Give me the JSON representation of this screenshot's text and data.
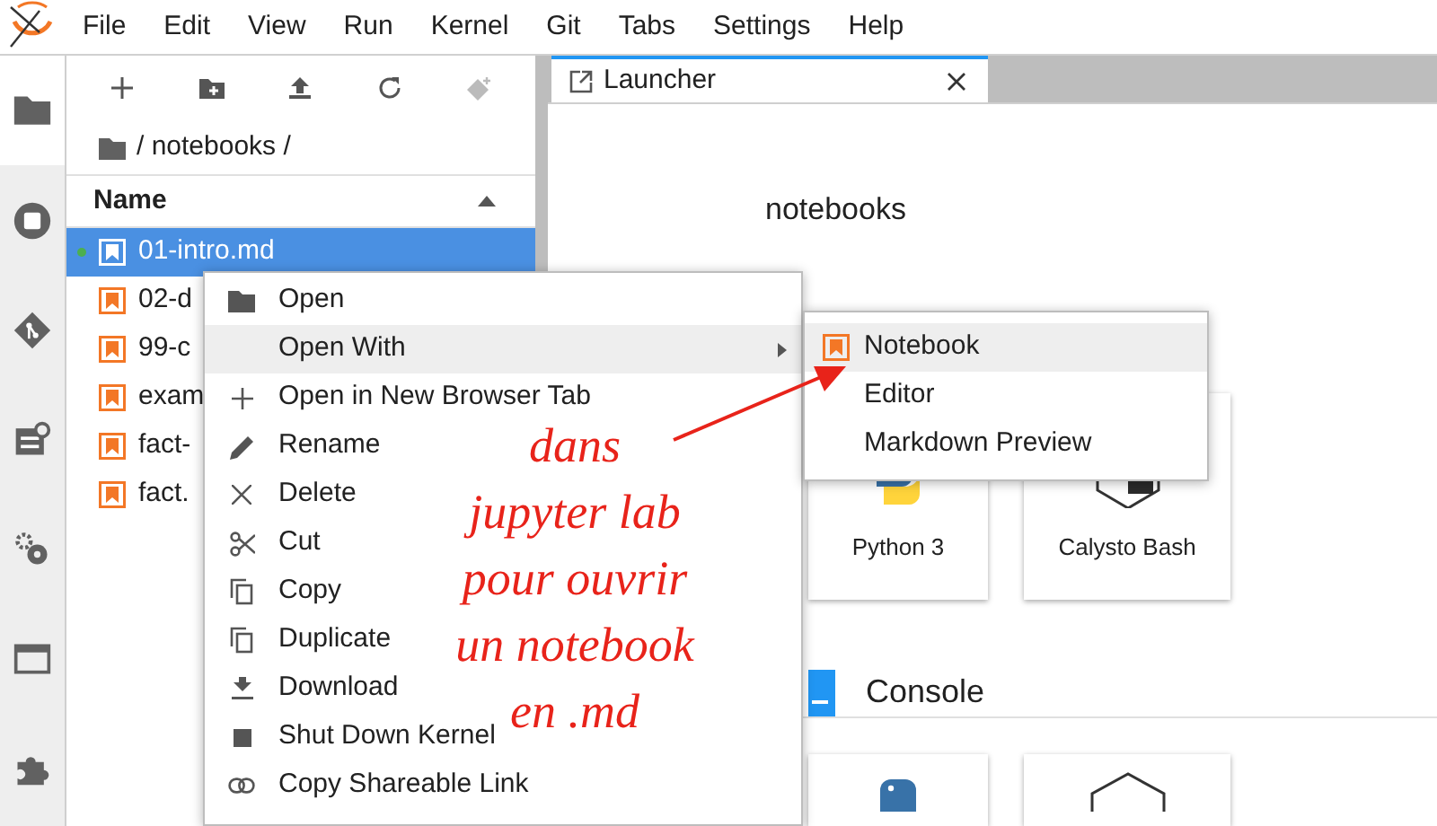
{
  "menu_bar": [
    "File",
    "Edit",
    "View",
    "Run",
    "Kernel",
    "Git",
    "Tabs",
    "Settings",
    "Help"
  ],
  "activity_bar": [
    {
      "selected": true
    },
    {
      "selected": false
    },
    {
      "selected": false
    },
    {
      "selected": false
    },
    {
      "selected": false
    },
    {
      "selected": false
    },
    {
      "selected": false
    }
  ],
  "file_browser": {
    "breadcrumb": "/ notebooks /",
    "column": "Name",
    "files": [
      {
        "name": "01-intro.md",
        "selected": true,
        "running": true
      },
      {
        "name": "02-d",
        "selected": false,
        "running": false
      },
      {
        "name": "99-c",
        "selected": false,
        "running": false
      },
      {
        "name": "exam",
        "selected": false,
        "running": false
      },
      {
        "name": "fact-",
        "selected": false,
        "running": false
      },
      {
        "name": "fact.",
        "selected": false,
        "running": false
      }
    ]
  },
  "tabs": [
    {
      "label": "Launcher",
      "selected": true
    }
  ],
  "launcher": {
    "folder": "notebooks",
    "notebook_cards": [
      "Python 3",
      "Calysto Bash"
    ],
    "console_section": "Console"
  },
  "context_menu": [
    {
      "label": "Open",
      "highlighted": false,
      "submenu": false
    },
    {
      "label": "Open With",
      "highlighted": true,
      "submenu": true
    },
    {
      "label": "Open in New Browser Tab",
      "highlighted": false,
      "submenu": false
    },
    {
      "label": "Rename",
      "highlighted": false,
      "submenu": false
    },
    {
      "label": "Delete",
      "highlighted": false,
      "submenu": false
    },
    {
      "label": "Cut",
      "highlighted": false,
      "submenu": false
    },
    {
      "label": "Copy",
      "highlighted": false,
      "submenu": false
    },
    {
      "label": "Duplicate",
      "highlighted": false,
      "submenu": false
    },
    {
      "label": "Download",
      "highlighted": false,
      "submenu": false
    },
    {
      "label": "Shut Down Kernel",
      "highlighted": false,
      "submenu": false
    },
    {
      "label": "Copy Shareable Link",
      "highlighted": false,
      "submenu": false
    }
  ],
  "submenu": [
    {
      "label": "Notebook",
      "highlighted": true
    },
    {
      "label": "Editor",
      "highlighted": false
    },
    {
      "label": "Markdown Preview",
      "highlighted": false
    }
  ],
  "annotation": [
    "dans",
    "jupyter lab",
    "pour ouvrir",
    "un notebook",
    "en .md"
  ]
}
